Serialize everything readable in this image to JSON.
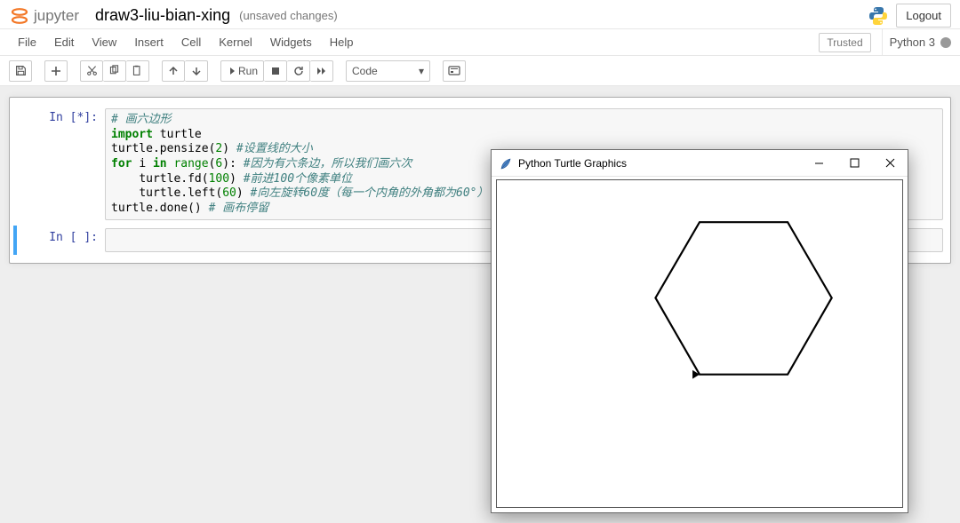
{
  "header": {
    "logo_text": "jupyter",
    "nb_title": "draw3-liu-bian-xing",
    "nb_status": "(unsaved changes)",
    "logout": "Logout"
  },
  "menu": {
    "items": [
      "File",
      "Edit",
      "View",
      "Insert",
      "Cell",
      "Kernel",
      "Widgets",
      "Help"
    ],
    "trusted": "Trusted",
    "kernel": "Python 3"
  },
  "toolbar": {
    "run_label": "Run",
    "cell_type": "Code"
  },
  "cells": {
    "prompt_running": "In [*]:",
    "prompt_empty": "In [ ]:",
    "code_lines": [
      {
        "t": "comment",
        "indent": 0,
        "tokens": [
          [
            "comment",
            "# 画六边形"
          ]
        ]
      },
      {
        "indent": 0,
        "tokens": [
          [
            "keyword",
            "import"
          ],
          [
            "sp",
            " "
          ],
          [
            "name",
            "turtle"
          ]
        ]
      },
      {
        "indent": 0,
        "tokens": [
          [
            "name",
            "turtle.pensize("
          ],
          [
            "number",
            "2"
          ],
          [
            "name",
            ") "
          ],
          [
            "comment",
            "#设置线的大小"
          ]
        ]
      },
      {
        "indent": 0,
        "tokens": [
          [
            "keyword",
            "for"
          ],
          [
            "sp",
            " "
          ],
          [
            "name",
            "i "
          ],
          [
            "keyword",
            "in"
          ],
          [
            "sp",
            " "
          ],
          [
            "builtin",
            "range"
          ],
          [
            "name",
            "("
          ],
          [
            "number",
            "6"
          ],
          [
            "name",
            "): "
          ],
          [
            "comment",
            "#因为有六条边，所以我们画六次"
          ]
        ]
      },
      {
        "indent": 1,
        "tokens": [
          [
            "name",
            "turtle.fd("
          ],
          [
            "number",
            "100"
          ],
          [
            "name",
            ") "
          ],
          [
            "comment",
            "#前进100个像素单位"
          ]
        ]
      },
      {
        "indent": 1,
        "tokens": [
          [
            "name",
            "turtle.left("
          ],
          [
            "number",
            "60"
          ],
          [
            "name",
            ") "
          ],
          [
            "comment",
            "#向左旋转60度（每一个内角的外角都为60°）"
          ]
        ]
      },
      {
        "indent": 0,
        "tokens": [
          [
            "name",
            "turtle.done() "
          ],
          [
            "comment",
            "# 画布停留"
          ]
        ]
      }
    ]
  },
  "turtle": {
    "title": "Python Turtle Graphics"
  }
}
